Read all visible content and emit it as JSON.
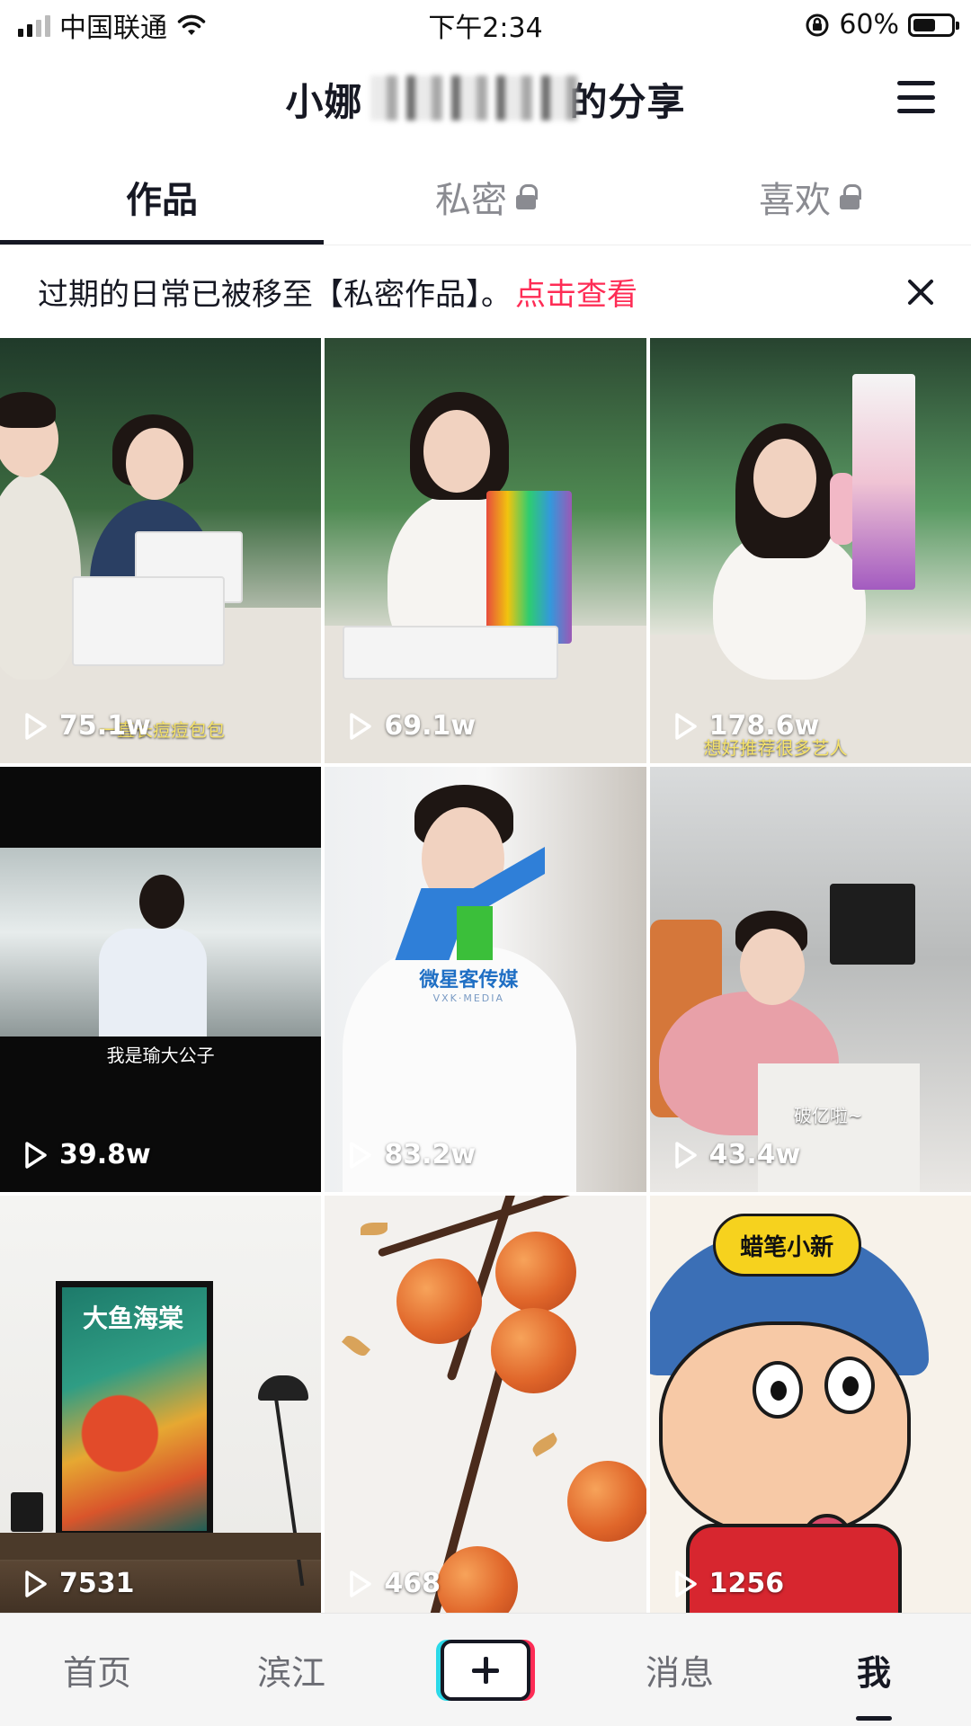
{
  "status_bar": {
    "carrier": "中国联通",
    "time": "下午2:34",
    "battery": "60%",
    "battery_level": 0.6
  },
  "header": {
    "title": "小娜",
    "title_suffix": "的分享",
    "menu_icon": "hamburger-menu-icon"
  },
  "tabs": [
    {
      "label": "作品",
      "active": true,
      "locked": false
    },
    {
      "label": "私密",
      "active": false,
      "locked": true
    },
    {
      "label": "喜欢",
      "active": false,
      "locked": true
    }
  ],
  "notice": {
    "text": "过期的日常已被移至【私密作品】。",
    "link": "点击查看",
    "close_icon": "close-icon"
  },
  "videos": [
    {
      "plays": "75.1w",
      "caption": "一直长痘痘包包"
    },
    {
      "plays": "69.1w",
      "caption": ""
    },
    {
      "plays": "178.6w",
      "caption": "想好推荐很多艺人"
    },
    {
      "plays": "39.8w",
      "caption": "我是瑜大公子"
    },
    {
      "plays": "83.2w",
      "caption": ""
    },
    {
      "plays": "43.4w",
      "caption": "破亿啦~"
    },
    {
      "plays": "7531",
      "caption": ""
    },
    {
      "plays": "468",
      "caption": ""
    },
    {
      "plays": "1256",
      "caption": ""
    }
  ],
  "thumb_text": {
    "poster_title": "大鱼海棠",
    "cartoon_badge": "蜡笔小新",
    "watermark_name": "微星客传媒",
    "watermark_sub": "VXK·MEDIA"
  },
  "bottom_nav": [
    {
      "label": "首页",
      "active": false
    },
    {
      "label": "滨江",
      "active": false
    },
    {
      "label": "",
      "active": false,
      "icon": "plus-icon"
    },
    {
      "label": "消息",
      "active": false
    },
    {
      "label": "我",
      "active": true
    }
  ],
  "colors": {
    "accent": "#fe2c55",
    "text": "#161823",
    "muted": "#8a8b91"
  }
}
